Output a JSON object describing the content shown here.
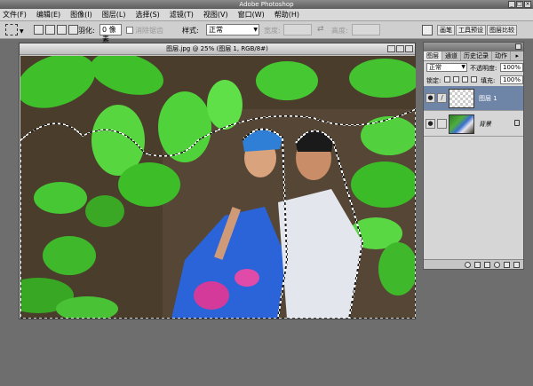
{
  "app": {
    "title": "Adobe Photoshop"
  },
  "menu": [
    "文件(F)",
    "编辑(E)",
    "图像(I)",
    "图层(L)",
    "选择(S)",
    "滤镜(T)",
    "视图(V)",
    "窗口(W)",
    "帮助(H)"
  ],
  "options": {
    "feather_label": "羽化:",
    "feather_value": "0 像素",
    "antialias_label": "消除锯齿",
    "style_label": "样式:",
    "style_value": "正常",
    "width_label": "宽度:",
    "height_label": "高度:"
  },
  "wells": [
    "画笔",
    "工具预设",
    "图层比较"
  ],
  "document": {
    "title": "图层.jpg @ 25% (图层 1, RGB/8#)"
  },
  "layers_panel": {
    "tabs": [
      "图层",
      "通道",
      "历史记录",
      "动作"
    ],
    "blend_mode": "正常",
    "opacity_label": "不透明度:",
    "opacity_value": "100%",
    "lock_label": "锁定:",
    "fill_label": "填充:",
    "fill_value": "100%",
    "layers": [
      {
        "name": "图层 1",
        "selected": true
      },
      {
        "name": "背景",
        "selected": false,
        "locked": true
      }
    ]
  },
  "colors": {
    "workspace": "#6e6e6e",
    "selected_layer": "#6f85a8",
    "leaf_green": "#3fbf2a"
  }
}
